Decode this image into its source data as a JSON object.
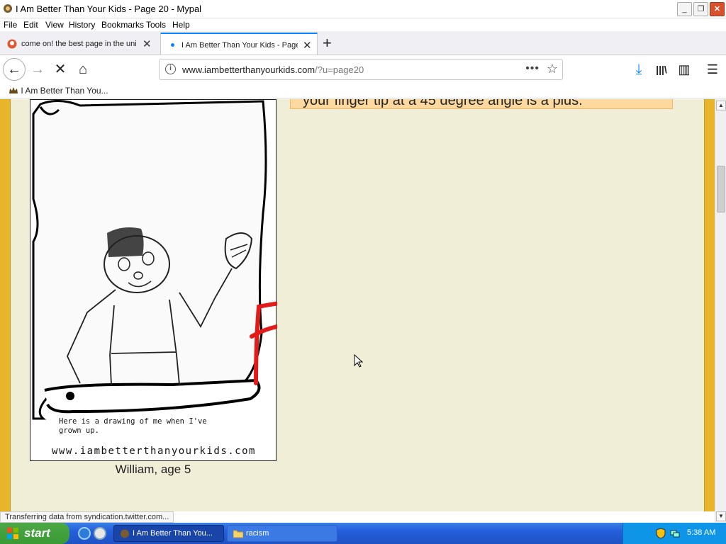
{
  "window": {
    "title": "I Am Better Than Your Kids - Page 20 - Mypal",
    "minimize": "_",
    "restore": "❐",
    "close": "✕"
  },
  "menu": [
    "File",
    "Edit",
    "View",
    "History",
    "Bookmarks",
    "Tools",
    "Help"
  ],
  "tabs": [
    {
      "label": "come on! the best page in the uni",
      "close": "✕"
    },
    {
      "label": "I Am Better Than Your Kids - Page",
      "close": "✕"
    }
  ],
  "new_tab": "+",
  "nav": {
    "back": "←",
    "forward": "→",
    "stop": "✕",
    "home": "⌂",
    "url_host": "www.iambetterthanyourkids.com",
    "url_path": "/?u=page20",
    "page_actions": "•••",
    "bookmark_star": "☆",
    "downloads": "⤓",
    "library": "|||\\",
    "sidebar": "▥",
    "menu": "☰"
  },
  "bookmarks": [
    {
      "label": "I Am Better Than You..."
    }
  ],
  "page": {
    "tip_text": "your finger tip at a 45 degree angle is a plus.",
    "comic_caption_line1": "Here is a drawing of me when I've",
    "comic_caption_line2": "grown up.",
    "comic_url": "www.iambetterthanyourkids.com",
    "artist": "William, age 5",
    "grade": "F"
  },
  "status_text": "Transferring data from syndication.twitter.com...",
  "taskbar": {
    "start_label": "start",
    "tasks": [
      {
        "label": "I Am Better Than You..."
      },
      {
        "label": "racism"
      }
    ],
    "clock": "5:38 AM"
  }
}
